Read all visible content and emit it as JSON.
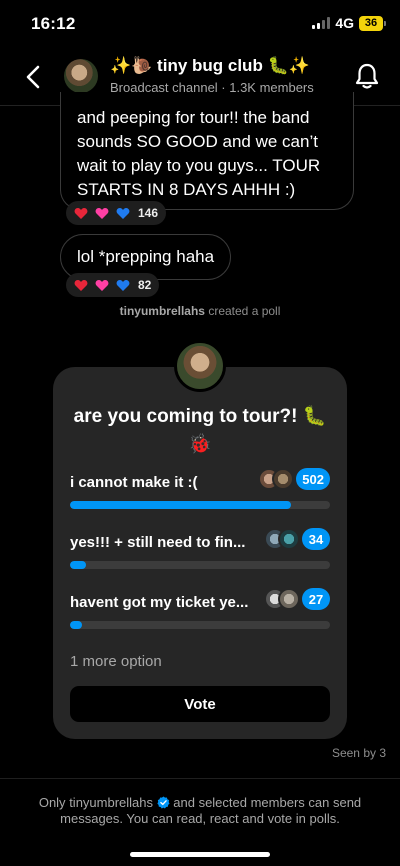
{
  "status": {
    "time": "16:12",
    "network": "4G",
    "battery": "36"
  },
  "header": {
    "title": "✨🐌 tiny bug club 🐛✨",
    "subtitle": "Broadcast channel · 1.3K members"
  },
  "messages": [
    {
      "text": "and peeping for tour!! the band sounds SO GOOD and we can’t wait to play to you guys... TOUR STARTS IN 8 DAYS AHHH :)",
      "reaction_count": "146"
    },
    {
      "text": "lol *prepping haha",
      "reaction_count": "82"
    }
  ],
  "system_note": {
    "user": "tinyumbrellahs",
    "action": "created a poll"
  },
  "poll": {
    "question": "are you coming to tour?! 🐛 🐞",
    "options": [
      {
        "label": "i cannot make it :(",
        "count": "502",
        "fraction": 0.85
      },
      {
        "label": "yes!!! + still need to fin...",
        "count": "34",
        "fraction": 0.06
      },
      {
        "label": "havent got my ticket ye...",
        "count": "27",
        "fraction": 0.045
      }
    ],
    "more": "1 more option",
    "vote_label": "Vote"
  },
  "seen": "Seen by 3",
  "footer": {
    "user": "tinyumbrellahs",
    "text_after": "and selected members can send messages. You can read, react and vote in polls.",
    "prefix": "Only"
  },
  "colors": {
    "accent": "#0095f6",
    "card": "#262626",
    "heart_red": "#e8263a",
    "heart_pink": "#ff3fa4",
    "heart_blue": "#1f7bf0"
  }
}
